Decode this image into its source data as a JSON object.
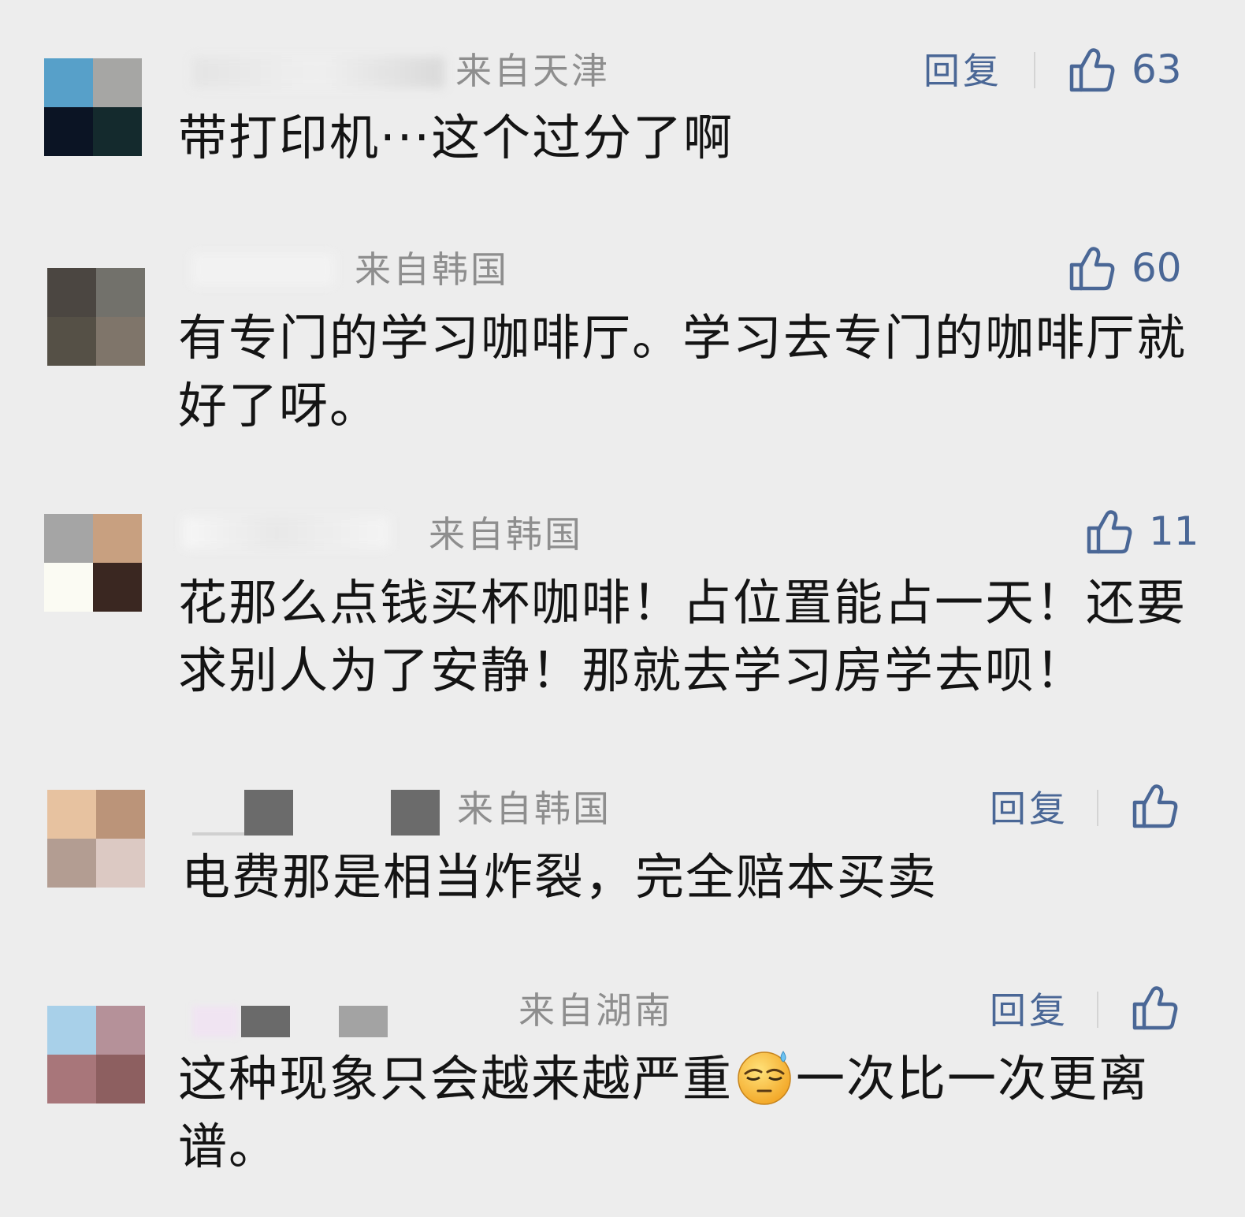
{
  "comments": [
    {
      "location": "来自天津",
      "reply_label": "回复",
      "like_count": "63",
      "text": "带打印机···这个过分了啊",
      "avatar": [
        "#57a0c9",
        "#a6a6a4",
        "#0b1424",
        "#142a2d"
      ],
      "name_blur": [
        "#e4e4e4",
        "#f0f0f0",
        "#d8d8d8"
      ]
    },
    {
      "location": "来自韩国",
      "like_count": "60",
      "text": "有专门的学习咖啡厅。学习去专门的咖啡厅就好了呀。",
      "avatar": [
        "#4b4641",
        "#72716b",
        "#555046",
        "#7f756a"
      ],
      "name_blur": [
        "#f2f2f2",
        "#f4f4f4"
      ]
    },
    {
      "location": "来自韩国",
      "like_count": "11",
      "text": "花那么点钱买杯咖啡！占位置能占一天！还要求别人为了安静！那就去学习房学去呗！",
      "avatar": [
        "#a5a5a5",
        "#c8a080",
        "#fbfbf3",
        "#3a2721"
      ],
      "name_blur": [
        "#f7f7f7",
        "#e8e8e8",
        "#f5f5f5"
      ]
    },
    {
      "location": "来自韩国",
      "reply_label": "回复",
      "text": "电费那是相当炸裂，完全赔本买卖",
      "avatar": [
        "#e7c2a0",
        "#bb9479",
        "#b39d92",
        "#dcc9c3"
      ],
      "name_blur": [
        "#cfcfcf",
        "#6b6b6b",
        "#6b6b6b"
      ]
    },
    {
      "location": "来自湖南",
      "reply_label": "回复",
      "text_before_emoji": "这种现象只会越来越严重",
      "emoji": "sweat-smile-emoji",
      "text_after_emoji": "一次比一次更离谱。",
      "avatar": [
        "#a8d0e9",
        "#b59199",
        "#a8767a",
        "#8d5f60"
      ],
      "name_blur": [
        "#f0e4f2",
        "#6a6a6a",
        "#a3a3a3"
      ]
    }
  ],
  "colors": {
    "background": "#ededed",
    "accent": "#4a6796",
    "meta_text": "#8e8e8e",
    "body_text": "#141414"
  }
}
